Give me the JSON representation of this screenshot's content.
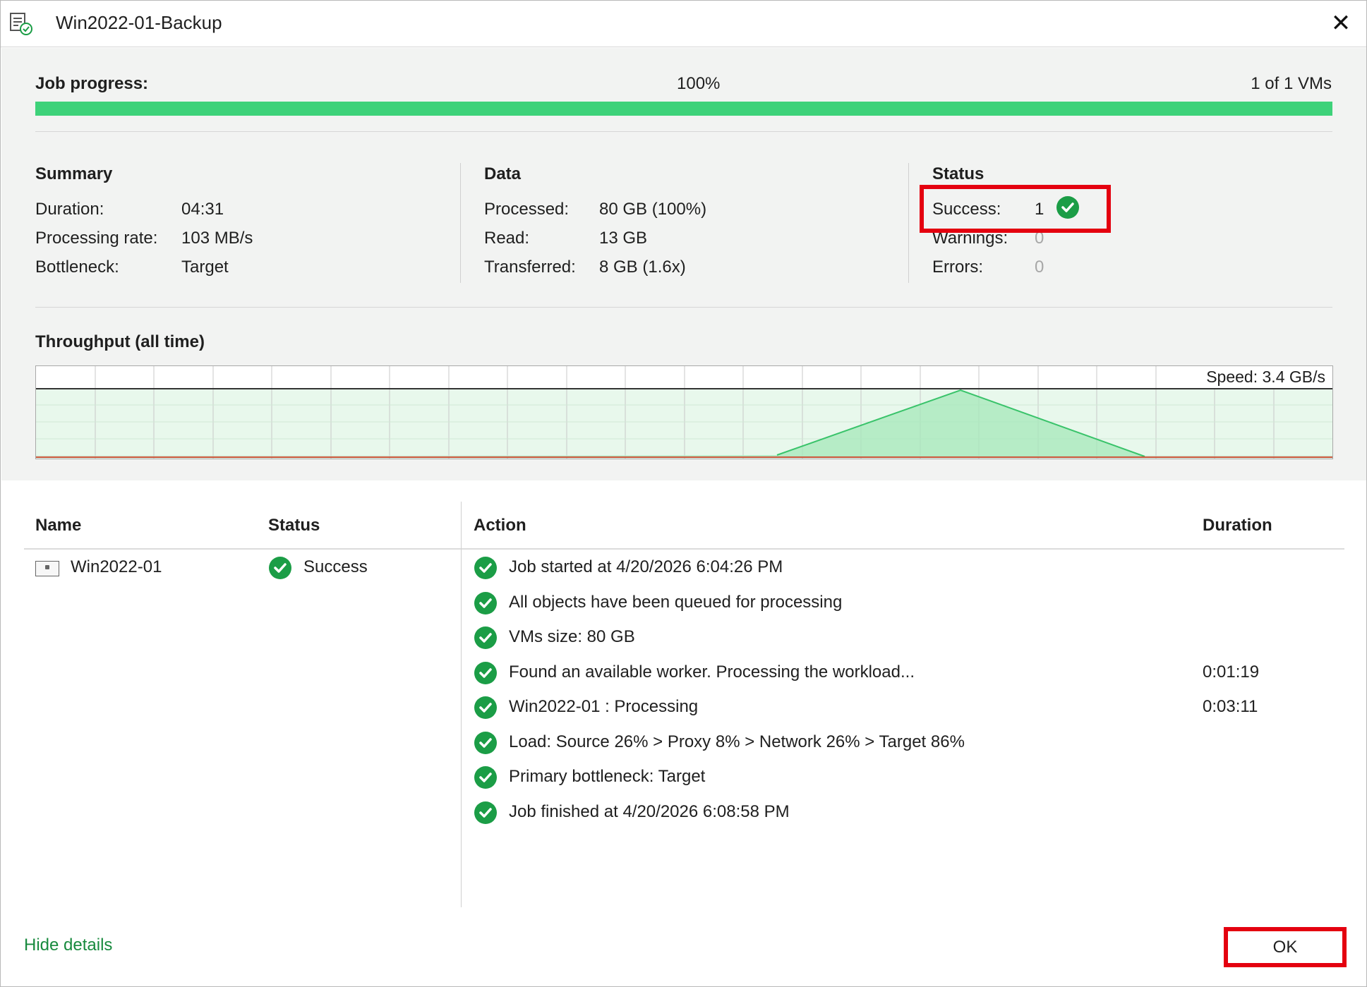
{
  "window": {
    "title": "Win2022-01-Backup",
    "close_icon": "close-icon",
    "app_icon": "job-log-icon"
  },
  "progress": {
    "label": "Job progress:",
    "percent_text": "100%",
    "percent_value": 100,
    "vms_text": "1 of 1 VMs",
    "bar_color": "#3ed27a"
  },
  "summary": {
    "heading": "Summary",
    "rows": [
      {
        "label": "Duration:",
        "value": "04:31"
      },
      {
        "label": "Processing rate:",
        "value": "103 MB/s"
      },
      {
        "label": "Bottleneck:",
        "value": "Target"
      }
    ]
  },
  "data_section": {
    "heading": "Data",
    "rows": [
      {
        "label": "Processed:",
        "value": "80 GB (100%)"
      },
      {
        "label": "Read:",
        "value": "13 GB"
      },
      {
        "label": "Transferred:",
        "value": "8 GB (1.6x)"
      }
    ]
  },
  "status_section": {
    "heading": "Status",
    "rows": [
      {
        "label": "Success:",
        "value": "1"
      },
      {
        "label": "Warnings:",
        "value": "0"
      },
      {
        "label": "Errors:",
        "value": "0"
      }
    ],
    "success_icon": "check-circle-icon",
    "success_color": "#1b9d46"
  },
  "throughput": {
    "title": "Throughput (all time)",
    "speed_label": "Speed: 3.4 GB/s"
  },
  "table": {
    "headers": {
      "name": "Name",
      "status": "Status",
      "action": "Action",
      "duration": "Duration"
    },
    "vm": {
      "name": "Win2022-01",
      "status": "Success"
    },
    "actions": [
      {
        "text": "Job started at 4/20/2026 6:04:26 PM",
        "duration": ""
      },
      {
        "text": "All objects have been queued for processing",
        "duration": ""
      },
      {
        "text": "VMs size: 80 GB",
        "duration": ""
      },
      {
        "text": "Found an available worker. Processing the workload...",
        "duration": "0:01:19"
      },
      {
        "text": "Win2022-01 : Processing",
        "duration": "0:03:11"
      },
      {
        "text": "Load: Source 26% > Proxy 8% > Network 26% > Target 86%",
        "duration": ""
      },
      {
        "text": "Primary bottleneck: Target",
        "duration": ""
      },
      {
        "text": "Job finished at 4/20/2026 6:08:58 PM",
        "duration": ""
      }
    ]
  },
  "footer": {
    "hide_details": "Hide details",
    "ok": "OK",
    "link_color": "#188a3e",
    "highlight_color": "#e4000f"
  }
}
